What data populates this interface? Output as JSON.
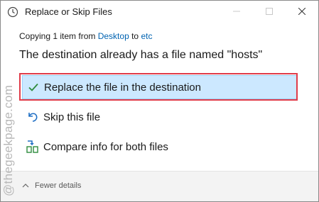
{
  "window": {
    "title": "Replace or Skip Files",
    "controls": {
      "minimize": "minimize-icon",
      "maximize": "maximize-icon",
      "close": "close-icon"
    }
  },
  "progress": {
    "prefix": "Copying 1 item from ",
    "source": "Desktop",
    "middle": " to ",
    "destination": "etc"
  },
  "headline": "The destination already has a file named \"hosts\"",
  "options": {
    "replace": {
      "label": "Replace the file in the destination",
      "icon": "checkmark-icon"
    },
    "skip": {
      "label": "Skip this file",
      "icon": "skip-arrow-icon"
    },
    "compare": {
      "label": "Compare info for both files",
      "icon": "compare-files-icon"
    }
  },
  "footer": {
    "details_label": "Fewer details",
    "icon": "chevron-up-icon"
  },
  "watermark": "@thegeekpage.com",
  "colors": {
    "accent": "#0063b1",
    "selection_bg": "#cce8ff",
    "highlight_border": "#e03c4a",
    "check_green": "#2e8b3d"
  }
}
